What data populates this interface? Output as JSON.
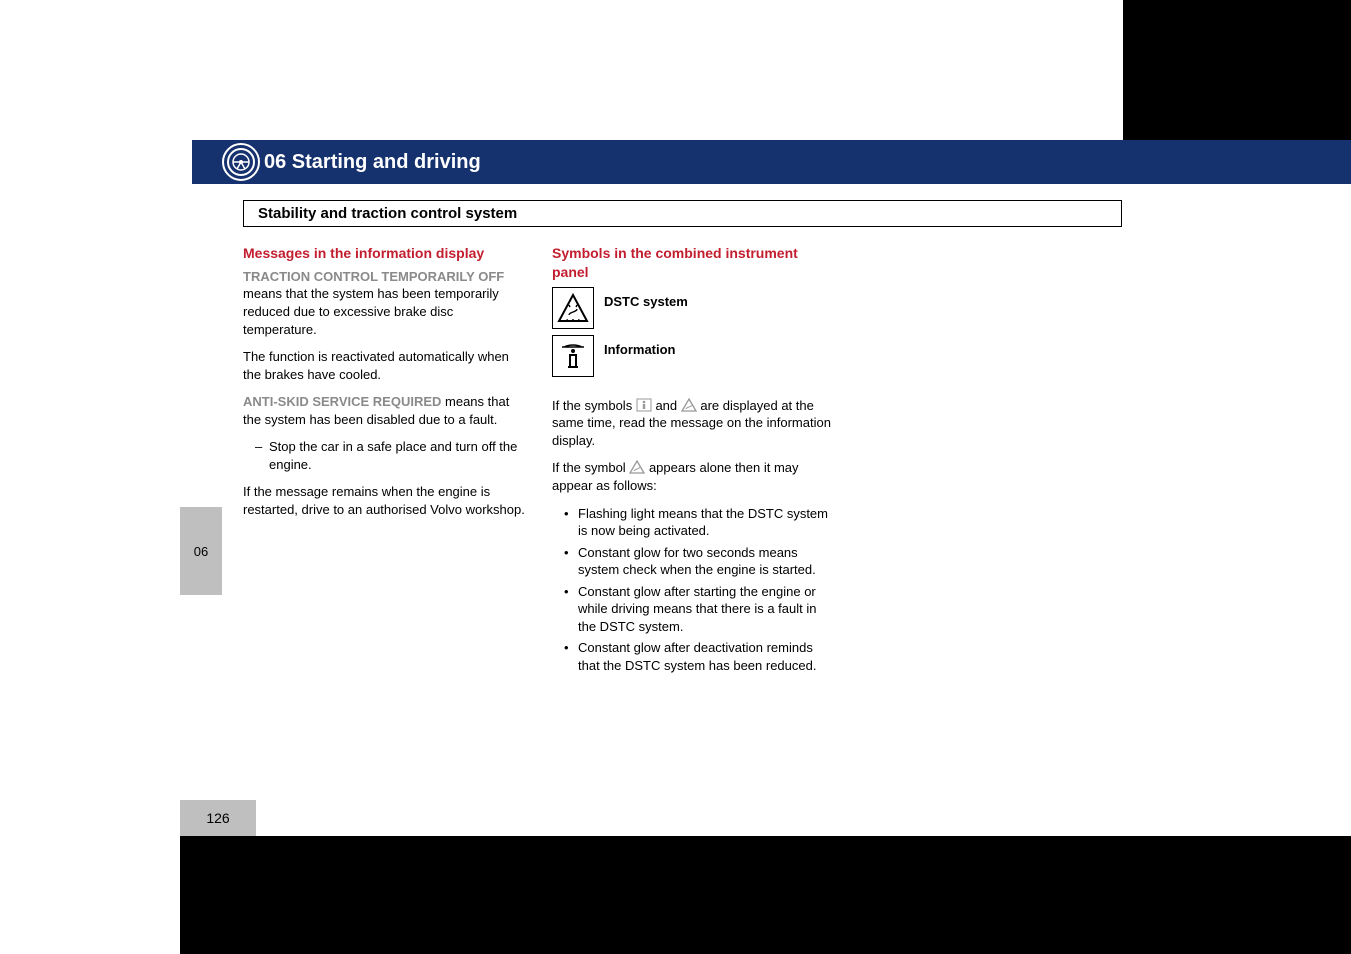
{
  "header": {
    "chapter_title": "06 Starting and driving",
    "subtitle": "Stability and traction control system"
  },
  "side": {
    "tab_label": "06",
    "page_number": "126"
  },
  "col1": {
    "heading": "Messages in the information display",
    "msg1_code": "TRACTION CONTROL TEMPORARILY OFF",
    "msg1_rest": " means that the system has been temporarily reduced due to excessive brake disc temperature.",
    "msg1b": "The function is reactivated automatically when the brakes have cooled.",
    "msg2_code": "ANTI-SKID SERVICE REQUIRED",
    "msg2_rest": " means that the system has been disabled due to a fault.",
    "dash1": "Stop the car in a safe place and turn off the engine.",
    "msg3": "If the message remains when the engine is restarted, drive to an authorised Volvo workshop."
  },
  "col2": {
    "heading": "Symbols in the combined instrument panel",
    "sym_dstc_label": "DSTC system",
    "sym_info_label": "Information",
    "p1a": "If the symbols ",
    "p1b": " and ",
    "p1c": " are displayed at the same time, read the message on the information display.",
    "p2a": "If the symbol ",
    "p2b": " appears alone then it may appear as follows:",
    "b1": "Flashing light means that the DSTC system is now being activated.",
    "b2": "Constant glow for two seconds means system check when the engine is started.",
    "b3": "Constant glow after starting the engine or while driving means that there is a fault in the DSTC system.",
    "b4": "Constant glow after deactivation reminds that the DSTC system has been reduced."
  }
}
